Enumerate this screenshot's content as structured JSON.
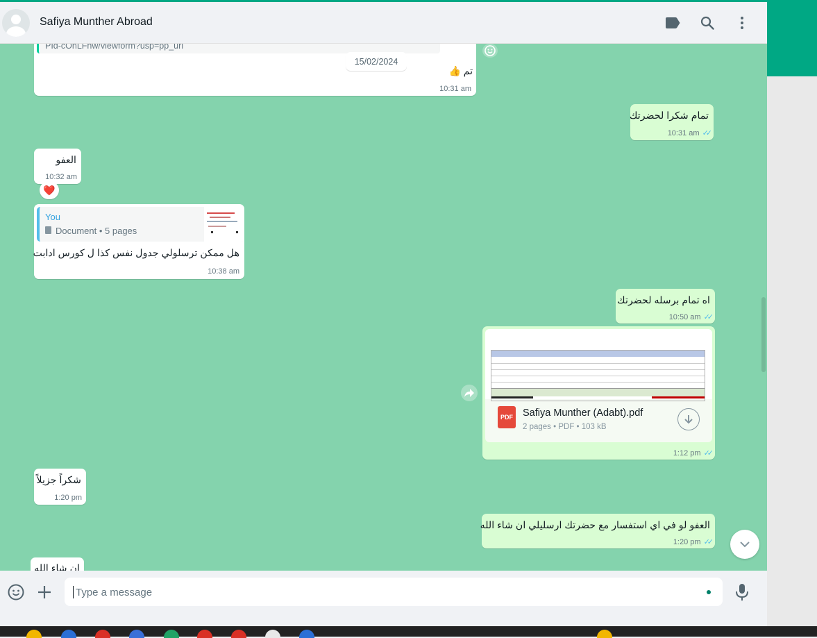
{
  "header": {
    "contact_name": "Safiya Munther Abroad",
    "icons": [
      "label-icon",
      "search-icon",
      "menu-dots-icon"
    ]
  },
  "chat": {
    "link_fragment": "PId-cOnLFhw/viewform?usp=pp_url",
    "date_separator": "15/02/2024",
    "messages": [
      {
        "dir": "in",
        "text": "تم 👍",
        "time": "10:31 am"
      },
      {
        "dir": "out",
        "text": "تمام شكرا لحضرتك",
        "time": "10:31 am"
      },
      {
        "dir": "in",
        "text": "العفو",
        "time": "10:32 am",
        "reaction": "❤️"
      },
      {
        "dir": "in",
        "reply_author": "You",
        "reply_text": "Document • 5 pages",
        "text": "هل ممكن ترسلولي جدول نفس كذا ل كورس ادابت",
        "time": "10:38 am"
      },
      {
        "dir": "out",
        "text": "اه تمام برسله لحضرتك",
        "time": "10:50 am"
      },
      {
        "dir": "out",
        "file_name": "Safiya Munther (Adabt).pdf",
        "file_meta": "2 pages • PDF • 103 kB",
        "file_badge": "PDF",
        "time": "1:12 pm"
      },
      {
        "dir": "in",
        "text": "شكراً جزيلاً",
        "time": "1:20 pm"
      },
      {
        "dir": "out",
        "text": "العفو لو في اي استفسار مع حضرتك ارسليلي ان شاء الله",
        "time": "1:20 pm"
      },
      {
        "dir": "in",
        "text": "ان شاء الله",
        "time": ""
      }
    ]
  },
  "composer": {
    "placeholder": "Type a message",
    "icons": [
      "emoji-icon",
      "attach-plus-icon",
      "microphone-icon"
    ]
  },
  "colors": {
    "accent": "#00a884",
    "chat_bg": "#84d3ad",
    "outgoing_bubble": "#d9fdd3",
    "incoming_bubble": "#ffffff",
    "read_ticks": "#53bdeb"
  }
}
